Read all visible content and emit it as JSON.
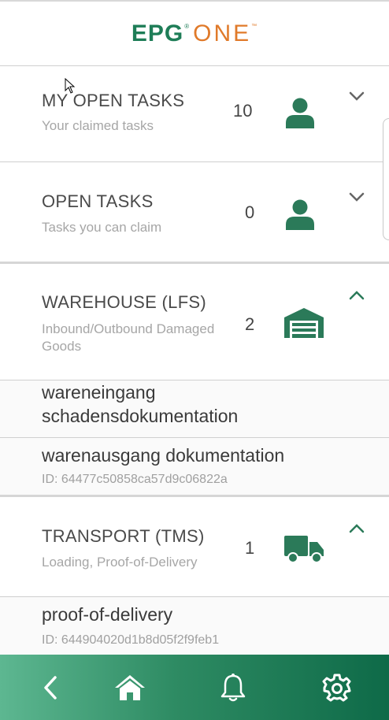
{
  "header": {
    "logo_main": "EPG",
    "logo_reg": "®",
    "logo_suffix": "ONE",
    "logo_tm": "™"
  },
  "sections": [
    {
      "title": "MY OPEN TASKS",
      "subtitle": "Your claimed tasks",
      "count": "10",
      "icon": "person-icon",
      "expanded": false
    },
    {
      "title": "OPEN TASKS",
      "subtitle": "Tasks you can claim",
      "count": "0",
      "icon": "person-icon",
      "expanded": false
    },
    {
      "title": "WAREHOUSE (LFS)",
      "subtitle_line1": "Inbound/Outbound Damaged",
      "subtitle_line2": "Goods",
      "count": "2",
      "icon": "warehouse-icon",
      "expanded": true,
      "items": [
        {
          "title_line1": "wareneingang",
          "title_line2": "schadensdokumentation"
        },
        {
          "title": "warenausgang dokumentation",
          "id": "ID: 64477c50858ca57d9c06822a"
        }
      ]
    },
    {
      "title": "TRANSPORT (TMS)",
      "subtitle": "Loading, Proof-of-Delivery",
      "count": "1",
      "icon": "truck-icon",
      "expanded": true,
      "items": [
        {
          "title": "proof-of-delivery",
          "id": "ID: 644904020d1b8d05f2f9feb1"
        }
      ]
    }
  ],
  "colors": {
    "brand_green": "#1e7d57",
    "brand_orange": "#e07a2a",
    "icon_green": "#2b7a59",
    "nav_gradient_start": "#5db791",
    "nav_gradient_end": "#0e6a48"
  },
  "bottom_nav": [
    "back-icon",
    "home-icon",
    "bell-icon",
    "gear-icon"
  ]
}
